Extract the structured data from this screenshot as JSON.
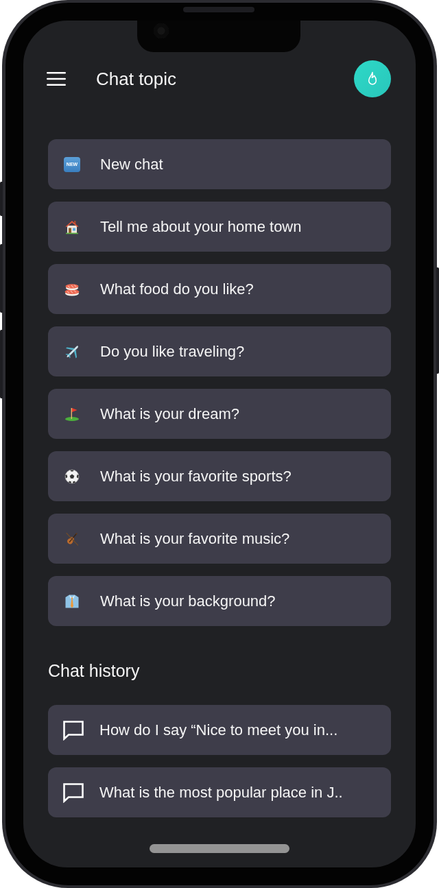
{
  "header": {
    "title": "Chat topic"
  },
  "topics": [
    {
      "kind": "new",
      "badge": "NEW",
      "label": "New chat"
    },
    {
      "kind": "house",
      "label": "Tell me about your home town"
    },
    {
      "kind": "sushi",
      "label": "What food do you like?"
    },
    {
      "kind": "airplane",
      "label": "Do you like traveling?"
    },
    {
      "kind": "flag",
      "label": "What is your dream?"
    },
    {
      "kind": "ball",
      "label": "What is your favorite sports?"
    },
    {
      "kind": "violin",
      "label": "What is your favorite music?"
    },
    {
      "kind": "shirt",
      "label": "What is your background?"
    }
  ],
  "history": {
    "title": "Chat history",
    "items": [
      {
        "label": "How do I say “Nice to meet you in..."
      },
      {
        "label": "What is the most popular place in J.."
      }
    ]
  }
}
